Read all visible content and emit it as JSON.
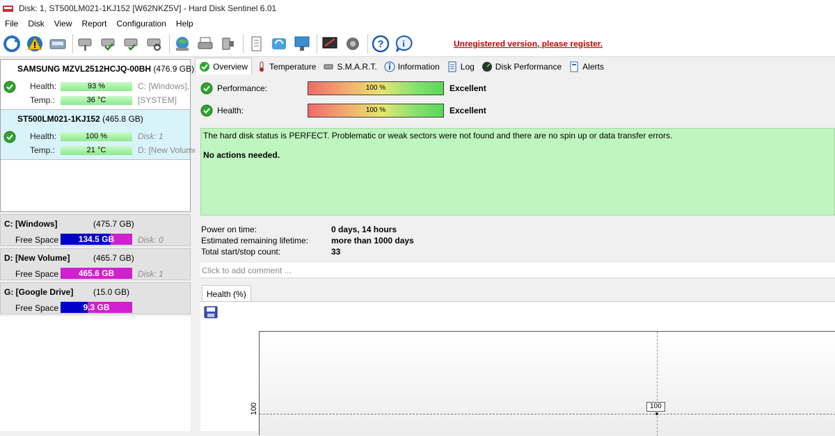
{
  "window": {
    "title": "Disk: 1, ST500LM021-1KJ152 [W62NKZ5V]  -  Hard Disk Sentinel 6.01"
  },
  "menu": [
    "File",
    "Disk",
    "View",
    "Report",
    "Configuration",
    "Help"
  ],
  "toolbar": {
    "register_text": "Unregistered version, please register."
  },
  "disks": [
    {
      "name": "SAMSUNG MZVL2512HCJQ-00BH",
      "size": "(476.9 GB)",
      "health_label": "Health:",
      "health": "93 %",
      "health_side": "C: [Windows],",
      "temp_label": "Temp.:",
      "temp": "36 °C",
      "temp_side": "[SYSTEM]"
    },
    {
      "name": "ST500LM021-1KJ152",
      "size": "(465.8 GB)",
      "health_label": "Health:",
      "health": "100 %",
      "health_side": "Disk: 1",
      "temp_label": "Temp.:",
      "temp": "21 °C",
      "temp_side": "D: [New Volume]"
    }
  ],
  "volumes": [
    {
      "name": "C: [Windows]",
      "size": "(475.7 GB)",
      "free_label": "Free Space",
      "free": "134.5 GB",
      "disk": "Disk: 0"
    },
    {
      "name": "D: [New Volume]",
      "size": "(465.7 GB)",
      "free_label": "Free Space",
      "free": "465.6 GB",
      "disk": "Disk: 1"
    },
    {
      "name": "G: [Google Drive]",
      "size": "(15.0 GB)",
      "free_label": "Free Space",
      "free": "9.3 GB",
      "disk": ""
    }
  ],
  "tabs": [
    "Overview",
    "Temperature",
    "S.M.A.R.T.",
    "Information",
    "Log",
    "Disk Performance",
    "Alerts"
  ],
  "overview": {
    "performance_label": "Performance:",
    "performance_value": "100 %",
    "performance_rating": "Excellent",
    "health_label": "Health:",
    "health_value": "100 %",
    "health_rating": "Excellent",
    "status_text": "The hard disk status is PERFECT. Problematic or weak sectors were not found and there are no spin up or data transfer errors.",
    "action_text": "No actions needed.",
    "power_on_label": "Power on time:",
    "power_on_value": "0 days, 14 hours",
    "lifetime_label": "Estimated remaining lifetime:",
    "lifetime_value": "more than 1000 days",
    "startstop_label": "Total start/stop count:",
    "startstop_value": "33",
    "comment_placeholder": "Click to add comment ...",
    "chart_tab": "Health (%)",
    "chart_ytick": "100",
    "chart_point_label": "100"
  },
  "colors": {
    "register": "#c00000",
    "selected_disk": "#d9f3fb",
    "status_bg": "#bff5bf"
  }
}
